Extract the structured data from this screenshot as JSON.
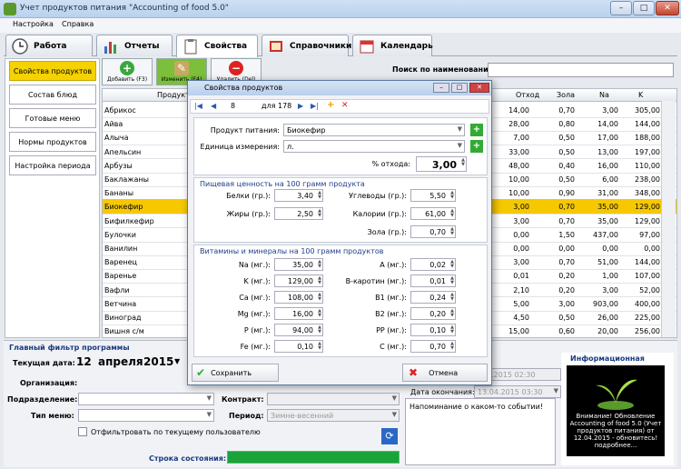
{
  "window": {
    "title": "Учет продуктов питания \"Accounting of food 5.0\""
  },
  "menu": [
    "Настройка",
    "Справка"
  ],
  "tabs": [
    {
      "label": "Работа",
      "icon": "clock-icon"
    },
    {
      "label": "Отчеты",
      "icon": "bar-chart-icon"
    },
    {
      "label": "Свойства",
      "icon": "clipboard-icon",
      "active": true
    },
    {
      "label": "Справочники",
      "icon": "book-icon"
    },
    {
      "label": "Календарь",
      "icon": "calendar-icon"
    }
  ],
  "sidebar": [
    {
      "label": "Свойства продуктов",
      "selected": true
    },
    {
      "label": "Состав блюд"
    },
    {
      "label": "Готовые меню"
    },
    {
      "label": "Нормы продуктов"
    },
    {
      "label": "Настройка периода"
    }
  ],
  "toolbar": {
    "add": "Добавить (F3)",
    "edit": "Изменить (F4)",
    "delete": "Удалить (Del)"
  },
  "search": {
    "label": "Поиск по наименованию:",
    "value": ""
  },
  "grid": {
    "headers": [
      "Продукт",
      "Отход",
      "Зола",
      "Na",
      "K"
    ],
    "rows": [
      {
        "name": "Абрикос",
        "waste": "14,00",
        "ash": "0,70",
        "na": "3,00",
        "k": "305,00"
      },
      {
        "name": "Айва",
        "waste": "28,00",
        "ash": "0,80",
        "na": "14,00",
        "k": "144,00"
      },
      {
        "name": "Алыча",
        "waste": "7,00",
        "ash": "0,50",
        "na": "17,00",
        "k": "188,00"
      },
      {
        "name": "Апельсин",
        "waste": "33,00",
        "ash": "0,50",
        "na": "13,00",
        "k": "197,00"
      },
      {
        "name": "Арбузы",
        "waste": "48,00",
        "ash": "0,40",
        "na": "16,00",
        "k": "110,00"
      },
      {
        "name": "Баклажаны",
        "waste": "10,00",
        "ash": "0,50",
        "na": "6,00",
        "k": "238,00"
      },
      {
        "name": "Бананы",
        "waste": "10,00",
        "ash": "0,90",
        "na": "31,00",
        "k": "348,00"
      },
      {
        "name": "Биокефир",
        "waste": "3,00",
        "ash": "0,70",
        "na": "35,00",
        "k": "129,00",
        "highlight": true
      },
      {
        "name": "Бифилкефир",
        "waste": "3,00",
        "ash": "0,70",
        "na": "35,00",
        "k": "129,00"
      },
      {
        "name": "Булочки",
        "waste": "0,00",
        "ash": "1,50",
        "na": "437,00",
        "k": "97,00"
      },
      {
        "name": "Ванилин",
        "waste": "0,00",
        "ash": "0,00",
        "na": "0,00",
        "k": "0,00"
      },
      {
        "name": "Варенец",
        "waste": "3,00",
        "ash": "0,70",
        "na": "51,00",
        "k": "144,00"
      },
      {
        "name": "Варенье",
        "waste": "0,01",
        "ash": "0,20",
        "na": "1,00",
        "k": "107,00"
      },
      {
        "name": "Вафли",
        "waste": "2,10",
        "ash": "0,20",
        "na": "3,00",
        "k": "52,00"
      },
      {
        "name": "Ветчина",
        "waste": "5,00",
        "ash": "3,00",
        "na": "903,00",
        "k": "400,00"
      },
      {
        "name": "Виноград",
        "waste": "4,50",
        "ash": "0,50",
        "na": "26,00",
        "k": "225,00"
      },
      {
        "name": "Вишня с/м",
        "waste": "15,00",
        "ash": "0,60",
        "na": "20,00",
        "k": "256,00"
      }
    ]
  },
  "dialog": {
    "title": "Свойства продуктов",
    "nav": {
      "current": "8",
      "total_label": "для 178"
    },
    "product_label": "Продукт питания:",
    "product_value": "Биокефир",
    "unit_label": "Единица измерения:",
    "unit_value": "л.",
    "waste_label": "% отхода:",
    "waste_value": "3,00",
    "nutrition_header": "Пищевая ценность на 100 грамм продукта",
    "nutrition": [
      {
        "label": "Белки (гр.):",
        "value": "3,40"
      },
      {
        "label": "Углеводы (гр.):",
        "value": "5,50"
      },
      {
        "label": "Жиры (гр.):",
        "value": "2,50"
      },
      {
        "label": "Калории (гр.):",
        "value": "61,00"
      },
      {
        "label": "Зола (гр.):",
        "value": "0,70"
      }
    ],
    "vitamins_header": "Витамины и минералы на 100 грамм продуктов",
    "vitamins_left": [
      {
        "label": "Na (мг.):",
        "value": "35,00"
      },
      {
        "label": "K (мг.):",
        "value": "129,00"
      },
      {
        "label": "Ca (мг.):",
        "value": "108,00"
      },
      {
        "label": "Mg (мг.):",
        "value": "16,00"
      },
      {
        "label": "P (мг.):",
        "value": "94,00"
      },
      {
        "label": "Fe (мг.):",
        "value": "0,10"
      }
    ],
    "vitamins_right": [
      {
        "label": "A (мг.):",
        "value": "0,02"
      },
      {
        "label": "B-каротин (мг.):",
        "value": "0,01"
      },
      {
        "label": "B1 (мг.):",
        "value": "0,24"
      },
      {
        "label": "B2 (мг.):",
        "value": "0,20"
      },
      {
        "label": "PP (мг.):",
        "value": "0,10"
      },
      {
        "label": "C (мг.):",
        "value": "0,70"
      }
    ],
    "save": "Сохранить",
    "cancel": "Отмена"
  },
  "bottom": {
    "filter_title": "Главный фильтр программы",
    "date_label": "Текущая дата:",
    "date_day": "12",
    "date_month": "апреля",
    "date_year": "2015",
    "org_label": "Организация:",
    "dept_label": "Подразделение:",
    "menu_type_label": "Тип меню:",
    "contract_label": "Контракт:",
    "period_label": "Период:",
    "period_value": "Зимне-весенний",
    "filter_user": "Отфильтровать по текущему пользователю",
    "status_label": "Строка состояния:",
    "start_date": "4.2015 02:30",
    "end_label": "Дата окончания:",
    "end_date": "13.04.2015 03:30",
    "memo": "Напоминание о каком-то событии!",
    "info_title": "Информационная",
    "info_text": "Внимание! Обновление Accounting of food 5.0 (Учет продуктов питания) от 12.04.2015 - обновитесь! подробнее..."
  }
}
